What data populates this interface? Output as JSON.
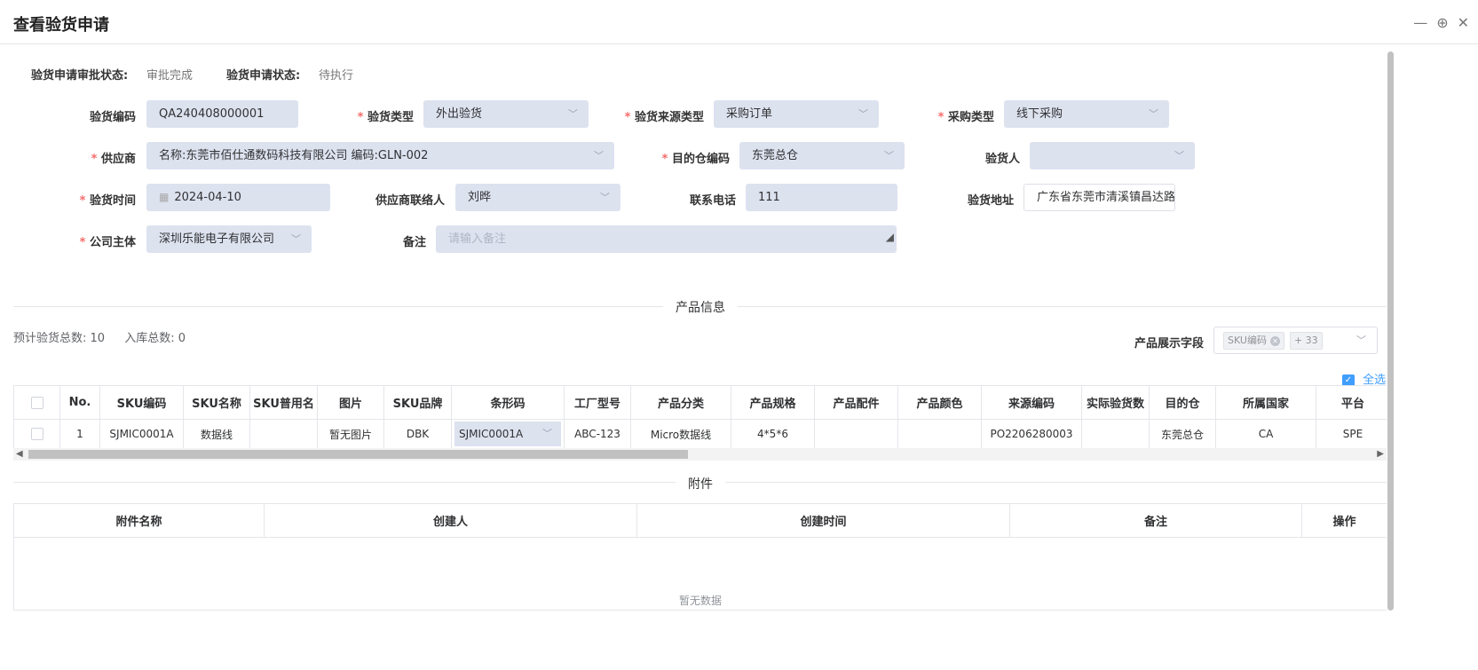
{
  "window": {
    "title": "查看验货申请"
  },
  "status": {
    "approval_label": "验货申请审批状态:",
    "approval_value": "审批完成",
    "state_label": "验货申请状态:",
    "state_value": "待执行"
  },
  "form": {
    "inspection_code": {
      "label": "验货编码",
      "value": "QA240408000001"
    },
    "inspection_type": {
      "label": "验货类型",
      "value": "外出验货"
    },
    "source_type": {
      "label": "验货来源类型",
      "value": "采购订单"
    },
    "purchase_type": {
      "label": "采购类型",
      "value": "线下采购"
    },
    "supplier": {
      "label": "供应商",
      "value": "名称:东莞市佰仕通数码科技有限公司  编码:GLN-002"
    },
    "dest_warehouse": {
      "label": "目的仓编码",
      "value": "东莞总仓"
    },
    "inspector": {
      "label": "验货人",
      "value": ""
    },
    "inspection_time": {
      "label": "验货时间",
      "value": "2024-04-10"
    },
    "supplier_contact": {
      "label": "供应商联络人",
      "value": "刘晔"
    },
    "phone": {
      "label": "联系电话",
      "value": "111"
    },
    "address": {
      "label": "验货地址",
      "value": "广东省东莞市清溪镇昌达路"
    },
    "company": {
      "label": "公司主体",
      "value": "深圳乐能电子有限公司"
    },
    "remark": {
      "label": "备注",
      "placeholder": "请输入备注"
    }
  },
  "product_section": {
    "title": "产品信息",
    "expected_label": "预计验货总数:",
    "expected_value": "10",
    "stored_label": "入库总数:",
    "stored_value": "0",
    "display_fields_label": "产品展示字段",
    "display_tag": "SKU编码",
    "display_more": "+ 33",
    "select_all": "全选",
    "columns": [
      "No.",
      "SKU编码",
      "SKU名称",
      "SKU普用名",
      "图片",
      "SKU品牌",
      "条形码",
      "工厂型号",
      "产品分类",
      "产品规格",
      "产品配件",
      "产品颜色",
      "来源编码",
      "实际验货数",
      "目的仓",
      "所属国家",
      "平台"
    ],
    "rows": [
      [
        "1",
        "SJMIC0001A",
        "数据线",
        "",
        "暂无图片",
        "DBK",
        "SJMIC0001A",
        "ABC-123",
        "Micro数据线",
        "4*5*6",
        "",
        "",
        "PO2206280003",
        "",
        "东莞总仓",
        "CA",
        "SPE"
      ]
    ]
  },
  "attachment_section": {
    "title": "附件",
    "columns": [
      "附件名称",
      "创建人",
      "创建时间",
      "备注",
      "操作"
    ],
    "empty_text": "暂无数据"
  },
  "icons": {
    "minimize": "minimize-icon",
    "zoom": "zoom-in-icon",
    "close": "close-icon",
    "chevron": "chevron-down-icon",
    "calendar": "calendar-icon",
    "check": "checkbox-icon"
  }
}
